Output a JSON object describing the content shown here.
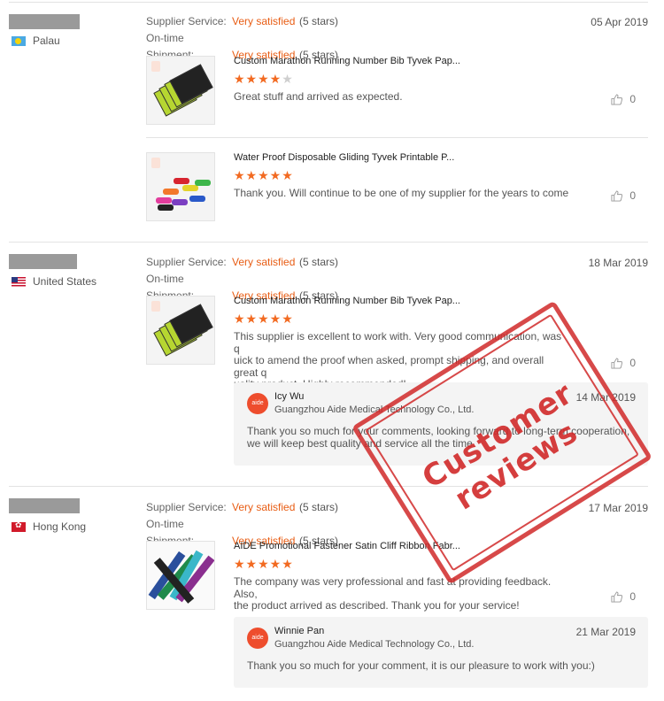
{
  "reviews": [
    {
      "country": "Palau",
      "supplier_label": "Supplier Service:",
      "supplier_value": "Very satisfied",
      "supplier_stars": "(5 stars)",
      "shipment_label": "On-time Shipment:",
      "shipment_value": "Very satisfied",
      "shipment_stars": "(5 stars)",
      "date": "05 Apr 2019",
      "products": [
        {
          "title": "Custom Marathon Running Number Bib Tyvek Pap...",
          "rating": 4,
          "text": "Great stuff and arrived as expected.",
          "likes": "0"
        },
        {
          "title": "Water Proof Disposable Gliding Tyvek Printable P...",
          "rating": 5,
          "text": "Thank you. Will continue to be one of my supplier for the years to come",
          "likes": "0"
        }
      ]
    },
    {
      "country": "United States",
      "supplier_label": "Supplier Service:",
      "supplier_value": "Very satisfied",
      "supplier_stars": "(5 stars)",
      "shipment_label": "On-time Shipment:",
      "shipment_value": "Very satisfied",
      "shipment_stars": "(5 stars)",
      "date": "18 Mar 2019",
      "products": [
        {
          "title": "Custom Marathon Running Number Bib Tyvek Pap...",
          "rating": 5,
          "text_lines": [
            "This supplier is excellent to work with.  Very good communication, was q",
            "uick to amend the proof when asked, prompt shipping, and overall great q",
            "uality product.  Highly recommended!"
          ],
          "likes": "0"
        }
      ],
      "reply": {
        "avatar": "aide",
        "name": "Icy Wu",
        "company": "Guangzhou Aide Medical Technology Co., Ltd.",
        "date": "14 Mar 2019",
        "text_lines": [
          "Thank you so much for your comments,  looking forward to long-term cooperation,",
          "we will keep best quality and service all the time."
        ]
      }
    },
    {
      "country": "Hong Kong",
      "supplier_label": "Supplier Service:",
      "supplier_value": "Very satisfied",
      "supplier_stars": "(5 stars)",
      "shipment_label": "On-time Shipment:",
      "shipment_value": "Very satisfied",
      "shipment_stars": "(5 stars)",
      "date": "17 Mar 2019",
      "products": [
        {
          "title": "AIDE Promotional Fastener Satin Cliff Ribbon Fabr...",
          "rating": 5,
          "text_lines": [
            "The company was very professional and fast at providing feedback. Also,",
            "the product arrived as described. Thank you for your service!"
          ],
          "likes": "0"
        }
      ],
      "reply": {
        "avatar": "aide",
        "name": "Winnie Pan",
        "company": "Guangzhou Aide Medical Technology Co., Ltd.",
        "date": "21 Mar 2019",
        "text_lines": [
          "Thank you so much for your comment, it is our pleasure to work with you:)"
        ]
      }
    }
  ],
  "stamp": {
    "text": "Customer reviews",
    "color": "#d12a2a"
  },
  "colors": {
    "accent": "#e85c13",
    "star": "#f26a21"
  }
}
